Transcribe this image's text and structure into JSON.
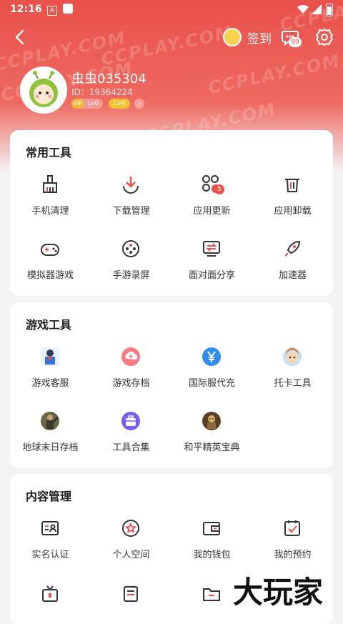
{
  "status_bar": {
    "time": "12:16",
    "notif_letter": "A"
  },
  "watermark": "CCPLAY.COM",
  "header": {
    "signin_label": "签到",
    "msg_count": "99"
  },
  "user": {
    "name": "虫虫035304",
    "id": "ID：19364224",
    "vip_level": "Lv0",
    "vip_badge": "VIP",
    "level": "Lv4"
  },
  "sections": [
    {
      "title": "常用工具",
      "items": [
        {
          "label": "手机清理",
          "icon": "broom-icon"
        },
        {
          "label": "下载管理",
          "icon": "download-icon"
        },
        {
          "label": "应用更新",
          "icon": "app-update-icon",
          "badge": "5"
        },
        {
          "label": "应用卸载",
          "icon": "trash-icon"
        },
        {
          "label": "模拟器游戏",
          "icon": "gamepad-icon"
        },
        {
          "label": "手游录屏",
          "icon": "record-icon"
        },
        {
          "label": "面对面分享",
          "icon": "share-icon"
        },
        {
          "label": "加速器",
          "icon": "rocket-icon"
        }
      ]
    },
    {
      "title": "游戏工具",
      "items": [
        {
          "label": "游戏客服",
          "icon": "customer-service-icon"
        },
        {
          "label": "游戏存档",
          "icon": "cloud-save-icon"
        },
        {
          "label": "国际服代充",
          "icon": "yen-icon"
        },
        {
          "label": "托卡工具",
          "icon": "toca-icon"
        },
        {
          "label": "地球末日存档",
          "icon": "last-day-icon"
        },
        {
          "label": "工具合集",
          "icon": "toolbox-icon"
        },
        {
          "label": "和平精英宝典",
          "icon": "pubg-icon"
        }
      ]
    },
    {
      "title": "内容管理",
      "items": [
        {
          "label": "实名认证",
          "icon": "id-card-icon"
        },
        {
          "label": "个人空间",
          "icon": "star-space-icon"
        },
        {
          "label": "我的钱包",
          "icon": "wallet-icon"
        },
        {
          "label": "我的预约",
          "icon": "calendar-check-icon"
        }
      ]
    }
  ],
  "brand_text": "大玩家",
  "colors": {
    "accent": "#e9514a",
    "header_bg": "#e9514a",
    "badge_yellow": "#f6c12f"
  }
}
